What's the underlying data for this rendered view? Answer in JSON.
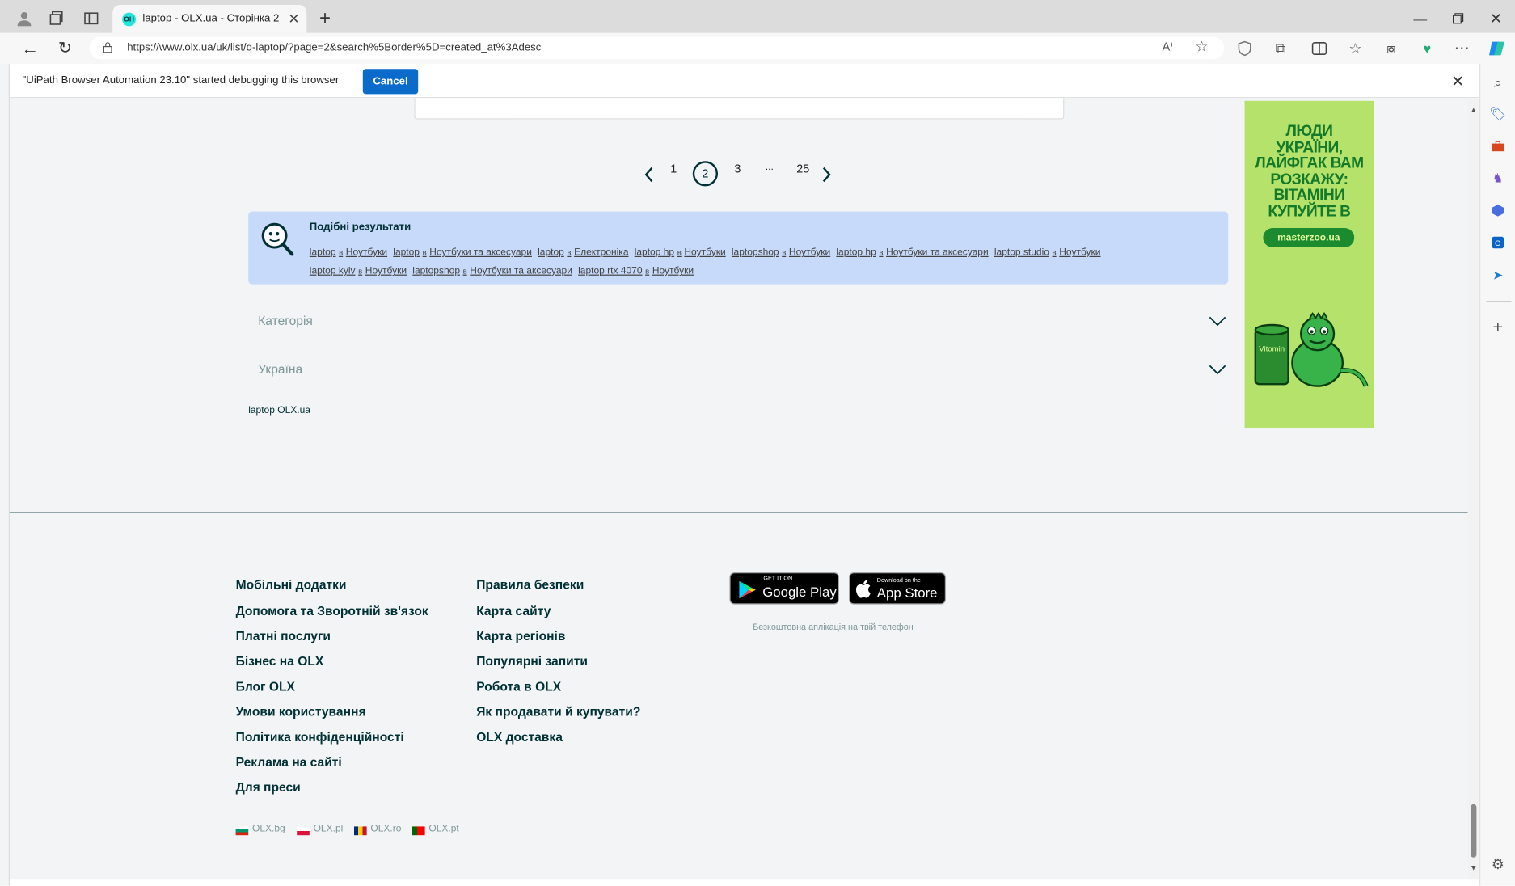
{
  "browser": {
    "tab_title": "laptop - OLX.ua - Сторінка 2",
    "url": "https://www.olx.ua/uk/list/q-laptop/?page=2&search%5Border%5D=created_at%3Adesc",
    "infobar_text": "\"UiPath Browser Automation 23.10\" started debugging this browser",
    "infobar_button": "Cancel"
  },
  "pagination": {
    "pages": [
      "1",
      "2",
      "3",
      "...",
      "25"
    ],
    "current": "2"
  },
  "related": {
    "title": "Подібні результати",
    "row1": [
      {
        "q": "laptop",
        "cat": "Ноутбуки"
      },
      {
        "q": "laptop",
        "cat": "Ноутбуки та аксесуари"
      },
      {
        "q": "laptop",
        "cat": "Електроніка"
      },
      {
        "q": "laptop hp",
        "cat": "Ноутбуки"
      },
      {
        "q": "laptopshop",
        "cat": "Ноутбуки"
      },
      {
        "q": "laptop hp",
        "cat": "Ноутбуки та аксесуари"
      },
      {
        "q": "laptop studio",
        "cat": "Ноутбуки"
      }
    ],
    "row2": [
      {
        "q": "laptop kyiv",
        "cat": "Ноутбуки"
      },
      {
        "q": "laptopshop",
        "cat": "Ноутбуки та аксесуари"
      },
      {
        "q": "laptop rtx 4070",
        "cat": "Ноутбуки"
      }
    ],
    "connector": "в"
  },
  "accordions": [
    "Категорія",
    "Україна"
  ],
  "seo_text": "laptop OLX.ua",
  "ad": {
    "headline": "ЛЮДИ УКРАЇНИ, ЛАЙФГАК ВАМ РОЗКАЖУ: ВІТАМІНИ КУПУЙТЕ В",
    "domain": "masterzoo.ua",
    "can_label": "Vitomin",
    "bg_color": "#b4e26a"
  },
  "footer": {
    "col1": [
      "Мобільні додатки",
      "Допомога та Зворотній зв'язок",
      "Платні послуги",
      "Бізнес на OLX",
      "Блог OLX",
      "Умови користування",
      "Політика конфіденційності",
      "Реклама на сайті",
      "Для преси"
    ],
    "col2": [
      "Правила безпеки",
      "Карта сайту",
      "Карта регіонів",
      "Популярні запити",
      "Робота в OLX",
      "Як продавати й купувати?",
      "OLX доставка"
    ],
    "google_play_small": "GET IT ON",
    "google_play_big": "Google Play",
    "app_store_small": "Download on the",
    "app_store_big": "App Store",
    "app_caption": "Безкоштовна аплікація на твій телефон",
    "country_sites": [
      "OLX.bg",
      "OLX.pl",
      "OLX.ro",
      "OLX.pt"
    ]
  },
  "colors": {
    "accent_blue": "#0b6bcb",
    "related_bg": "#c8daf9",
    "footer_text": "#002f34"
  }
}
